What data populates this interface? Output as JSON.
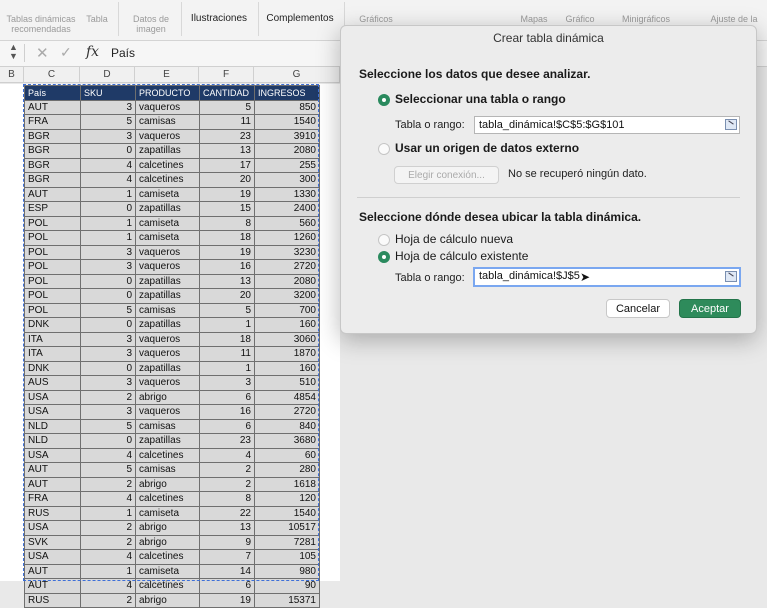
{
  "ribbon": {
    "items": [
      "Tablas dinámicas recomendadas",
      "Tabla",
      "Datos de imagen",
      "Ilustraciones",
      "Complementos",
      "Gráficos",
      "Mapas",
      "Gráfico",
      "Minigráficos",
      "Ajuste de la"
    ],
    "active": [
      "Ilustraciones",
      "Complementos"
    ]
  },
  "formula_bar": {
    "fx": "fx",
    "value": "País"
  },
  "columns": [
    "B",
    "C",
    "D",
    "E",
    "F",
    "G"
  ],
  "table": {
    "headers": [
      "País",
      "SKU",
      "PRODUCTO",
      "CANTIDAD",
      "INGRESOS"
    ],
    "rows": [
      [
        "AUT",
        "3",
        "vaqueros",
        "5",
        "850"
      ],
      [
        "FRA",
        "5",
        "camisas",
        "11",
        "1540"
      ],
      [
        "BGR",
        "3",
        "vaqueros",
        "23",
        "3910"
      ],
      [
        "BGR",
        "0",
        "zapatillas",
        "13",
        "2080"
      ],
      [
        "BGR",
        "4",
        "calcetines",
        "17",
        "255"
      ],
      [
        "BGR",
        "4",
        "calcetines",
        "20",
        "300"
      ],
      [
        "AUT",
        "1",
        "camiseta",
        "19",
        "1330"
      ],
      [
        "ESP",
        "0",
        "zapatillas",
        "15",
        "2400"
      ],
      [
        "POL",
        "1",
        "camiseta",
        "8",
        "560"
      ],
      [
        "POL",
        "1",
        "camiseta",
        "18",
        "1260"
      ],
      [
        "POL",
        "3",
        "vaqueros",
        "19",
        "3230"
      ],
      [
        "POL",
        "3",
        "vaqueros",
        "16",
        "2720"
      ],
      [
        "POL",
        "0",
        "zapatillas",
        "13",
        "2080"
      ],
      [
        "POL",
        "0",
        "zapatillas",
        "20",
        "3200"
      ],
      [
        "POL",
        "5",
        "camisas",
        "5",
        "700"
      ],
      [
        "DNK",
        "0",
        "zapatillas",
        "1",
        "160"
      ],
      [
        "ITA",
        "3",
        "vaqueros",
        "18",
        "3060"
      ],
      [
        "ITA",
        "3",
        "vaqueros",
        "11",
        "1870"
      ],
      [
        "DNK",
        "0",
        "zapatillas",
        "1",
        "160"
      ],
      [
        "AUS",
        "3",
        "vaqueros",
        "3",
        "510"
      ],
      [
        "USA",
        "2",
        "abrigo",
        "6",
        "4854"
      ],
      [
        "USA",
        "3",
        "vaqueros",
        "16",
        "2720"
      ],
      [
        "NLD",
        "5",
        "camisas",
        "6",
        "840"
      ],
      [
        "NLD",
        "0",
        "zapatillas",
        "23",
        "3680"
      ],
      [
        "USA",
        "4",
        "calcetines",
        "4",
        "60"
      ],
      [
        "AUT",
        "5",
        "camisas",
        "2",
        "280"
      ],
      [
        "AUT",
        "2",
        "abrigo",
        "2",
        "1618"
      ],
      [
        "FRA",
        "4",
        "calcetines",
        "8",
        "120"
      ],
      [
        "RUS",
        "1",
        "camiseta",
        "22",
        "1540"
      ],
      [
        "USA",
        "2",
        "abrigo",
        "13",
        "10517"
      ],
      [
        "SVK",
        "2",
        "abrigo",
        "9",
        "7281"
      ],
      [
        "USA",
        "4",
        "calcetines",
        "7",
        "105"
      ],
      [
        "AUT",
        "1",
        "camiseta",
        "14",
        "980"
      ],
      [
        "AUT",
        "4",
        "calcetines",
        "6",
        "90"
      ],
      [
        "RUS",
        "2",
        "abrigo",
        "19",
        "15371"
      ]
    ]
  },
  "dialog": {
    "title": "Crear tabla dinámica",
    "section1": "Seleccione los datos que desee analizar.",
    "opt_range": "Seleccionar una tabla o rango",
    "range_label": "Tabla o rango:",
    "range_value": "tabla_dinámica!$C$5:$G$101",
    "opt_external": "Usar un origen de datos externo",
    "choose_connection": "Elegir conexión...",
    "no_data": "No se recuperó ningún dato.",
    "section2": "Seleccione dónde desea ubicar la tabla dinámica.",
    "opt_new_sheet": "Hoja de cálculo nueva",
    "opt_existing": "Hoja de cálculo existente",
    "dest_label": "Tabla o rango:",
    "dest_value": "tabla_dinámica!$J$5",
    "cancel": "Cancelar",
    "ok": "Aceptar",
    "accent": "#2e8b5b"
  }
}
